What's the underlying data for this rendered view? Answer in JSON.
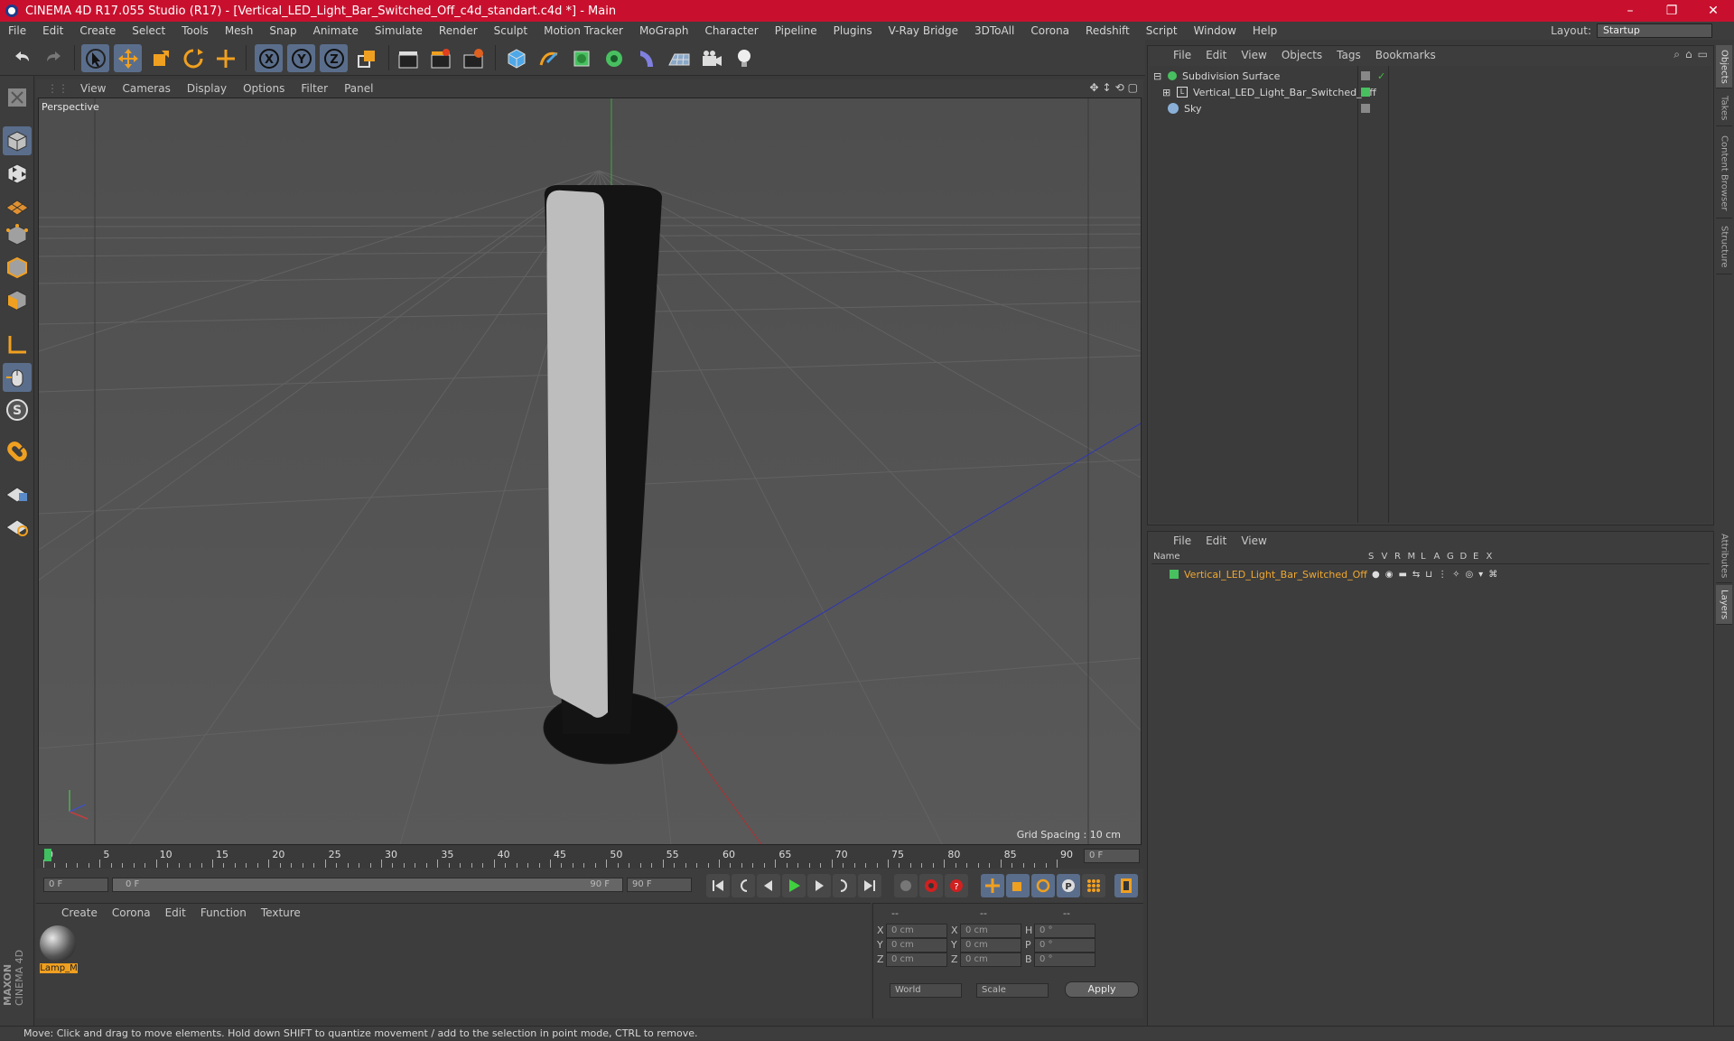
{
  "titlebar": {
    "title": "CINEMA 4D R17.055 Studio (R17) - [Vertical_LED_Light_Bar_Switched_Off_c4d_standart.c4d *] - Main",
    "minimize": "–",
    "maximize": "❐",
    "close": "✕"
  },
  "menu": [
    "File",
    "Edit",
    "Create",
    "Select",
    "Tools",
    "Mesh",
    "Snap",
    "Animate",
    "Simulate",
    "Render",
    "Sculpt",
    "Motion Tracker",
    "MoGraph",
    "Character",
    "Pipeline",
    "Plugins",
    "V-Ray Bridge",
    "3DToAll",
    "Corona",
    "Redshift",
    "Script",
    "Window",
    "Help"
  ],
  "layout": {
    "label": "Layout:",
    "value": "Startup"
  },
  "viewport": {
    "menu": [
      "View",
      "Cameras",
      "Display",
      "Options",
      "Filter",
      "Panel"
    ],
    "label": "Perspective",
    "grid_spacing": "Grid Spacing : 10 cm"
  },
  "timeline": {
    "ticks": [
      "0",
      "5",
      "10",
      "15",
      "20",
      "25",
      "30",
      "35",
      "40",
      "45",
      "50",
      "55",
      "60",
      "65",
      "70",
      "75",
      "80",
      "85",
      "90"
    ],
    "frame_field": "0 F"
  },
  "transport": {
    "start": "0 F",
    "range_start": "0 F",
    "range_end": "90 F",
    "end": "90 F"
  },
  "materials": {
    "menu": [
      "Create",
      "Corona",
      "Edit",
      "Function",
      "Texture"
    ],
    "items": [
      {
        "name": "Lamp_M"
      }
    ]
  },
  "coords": {
    "head": [
      "--",
      "--",
      "--"
    ],
    "rows": [
      {
        "a": "X",
        "v1": "0 cm",
        "b": "X",
        "v2": "0 cm",
        "c": "H",
        "v3": "0 °"
      },
      {
        "a": "Y",
        "v1": "0 cm",
        "b": "Y",
        "v2": "0 cm",
        "c": "P",
        "v3": "0 °"
      },
      {
        "a": "Z",
        "v1": "0 cm",
        "b": "Z",
        "v2": "0 cm",
        "c": "B",
        "v3": "0 °"
      }
    ],
    "world": "World",
    "scale": "Scale",
    "apply": "Apply"
  },
  "objects": {
    "menu": [
      "File",
      "Edit",
      "View",
      "Objects",
      "Tags",
      "Bookmarks"
    ],
    "items": [
      {
        "name": "Subdivision Surface"
      },
      {
        "name": "Vertical_LED_Light_Bar_Switched_Off"
      },
      {
        "name": "Sky"
      }
    ]
  },
  "layers": {
    "menu": [
      "File",
      "Edit",
      "View"
    ],
    "columns": [
      "Name",
      "S",
      "V",
      "R",
      "M",
      "L",
      "A",
      "G",
      "D",
      "E",
      "X"
    ],
    "items": [
      {
        "name": "Vertical_LED_Light_Bar_Switched_Off"
      }
    ]
  },
  "right_tabs": [
    "Objects",
    "Takes",
    "Content Browser",
    "Structure",
    "Attributes",
    "Layers"
  ],
  "status": "Move: Click and drag to move elements. Hold down SHIFT to quantize movement / add to the selection in point mode, CTRL to remove.",
  "brand": {
    "line1": "MAXON",
    "line2": "CINEMA 4D"
  }
}
